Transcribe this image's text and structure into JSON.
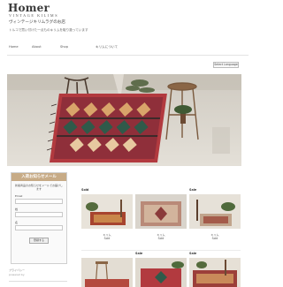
{
  "header": {
    "logo": "Homer",
    "logo_sub": "VINTAGE KILIMS",
    "tagline": "ヴィンテージキリムラグのお店",
    "description": "トルコで買い付けた一点ものキリムを取り扱っています"
  },
  "nav": {
    "items": [
      "Home",
      "About",
      "Shop",
      "キリムについて"
    ]
  },
  "lang_button": "Select Language",
  "hero": {
    "colors": {
      "rug_red": "#b23a3f",
      "rug_green": "#2f5a4a",
      "floor": "#d8d4cc"
    }
  },
  "newsletter": {
    "title": "入荷お知らせメール",
    "text": "新着商品のお知らせをメールでお届けします",
    "fields": [
      {
        "label": "Email"
      },
      {
        "label": "姓"
      },
      {
        "label": "名"
      }
    ],
    "button": "登録する",
    "note": "プライバシー",
    "note2": "powered by"
  },
  "products": [
    {
      "badge": "Sold",
      "name": "キリム",
      "price": "Sold"
    },
    {
      "badge": "",
      "name": "キリム",
      "price": "Sold"
    },
    {
      "badge": "Sale",
      "name": "キリム",
      "price": "Sold"
    },
    {
      "badge": "",
      "name": "",
      "price": ""
    },
    {
      "badge": "Sale",
      "name": "",
      "price": ""
    },
    {
      "badge": "Sale",
      "name": "",
      "price": ""
    }
  ]
}
